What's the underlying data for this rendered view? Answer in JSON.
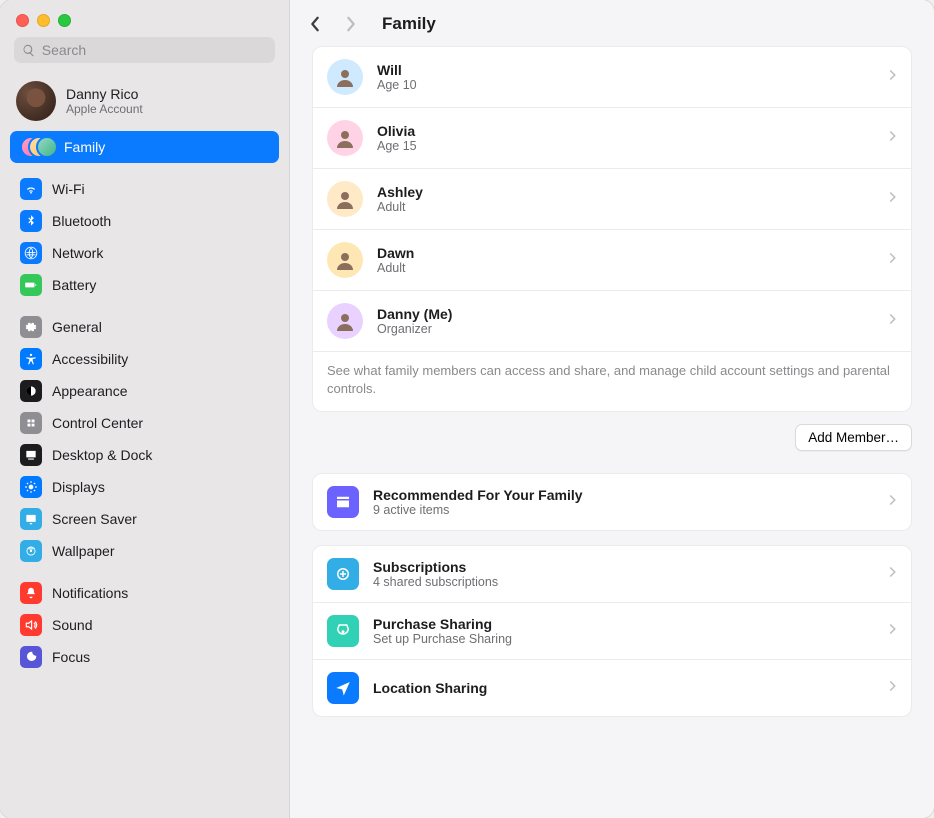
{
  "window": {
    "title": "Family"
  },
  "search": {
    "placeholder": "Search"
  },
  "account": {
    "name": "Danny Rico",
    "subtitle": "Apple Account"
  },
  "sidebar": {
    "family_label": "Family",
    "groups": [
      [
        {
          "key": "wifi",
          "label": "Wi-Fi"
        },
        {
          "key": "bluetooth",
          "label": "Bluetooth"
        },
        {
          "key": "network",
          "label": "Network"
        },
        {
          "key": "battery",
          "label": "Battery"
        }
      ],
      [
        {
          "key": "general",
          "label": "General"
        },
        {
          "key": "accessibility",
          "label": "Accessibility"
        },
        {
          "key": "appearance",
          "label": "Appearance"
        },
        {
          "key": "controlcenter",
          "label": "Control Center"
        },
        {
          "key": "desktopdock",
          "label": "Desktop & Dock"
        },
        {
          "key": "displays",
          "label": "Displays"
        },
        {
          "key": "screensaver",
          "label": "Screen Saver"
        },
        {
          "key": "wallpaper",
          "label": "Wallpaper"
        }
      ],
      [
        {
          "key": "notifications",
          "label": "Notifications"
        },
        {
          "key": "sound",
          "label": "Sound"
        },
        {
          "key": "focus",
          "label": "Focus"
        }
      ]
    ]
  },
  "main": {
    "title": "Family",
    "members": [
      {
        "name": "Will",
        "sub": "Age 10",
        "bg": "#cfeaff"
      },
      {
        "name": "Olivia",
        "sub": "Age 15",
        "bg": "#ffd3e5"
      },
      {
        "name": "Ashley",
        "sub": "Adult",
        "bg": "#ffe9c7"
      },
      {
        "name": "Dawn",
        "sub": "Adult",
        "bg": "#ffe7b3"
      },
      {
        "name": "Danny (Me)",
        "sub": "Organizer",
        "bg": "#e9d2ff"
      }
    ],
    "members_footnote": "See what family members can access and share, and manage child account settings and parental controls.",
    "add_member": "Add Member…",
    "recommended": {
      "title": "Recommended For Your Family",
      "sub": "9 active items"
    },
    "features": [
      {
        "key": "subscriptions",
        "title": "Subscriptions",
        "sub": "4 shared subscriptions",
        "color": "#32ade6"
      },
      {
        "key": "purchase",
        "title": "Purchase Sharing",
        "sub": "Set up Purchase Sharing",
        "color": "#30d1b5"
      },
      {
        "key": "location",
        "title": "Location Sharing",
        "sub": "",
        "color": "#0a7aff"
      }
    ]
  }
}
